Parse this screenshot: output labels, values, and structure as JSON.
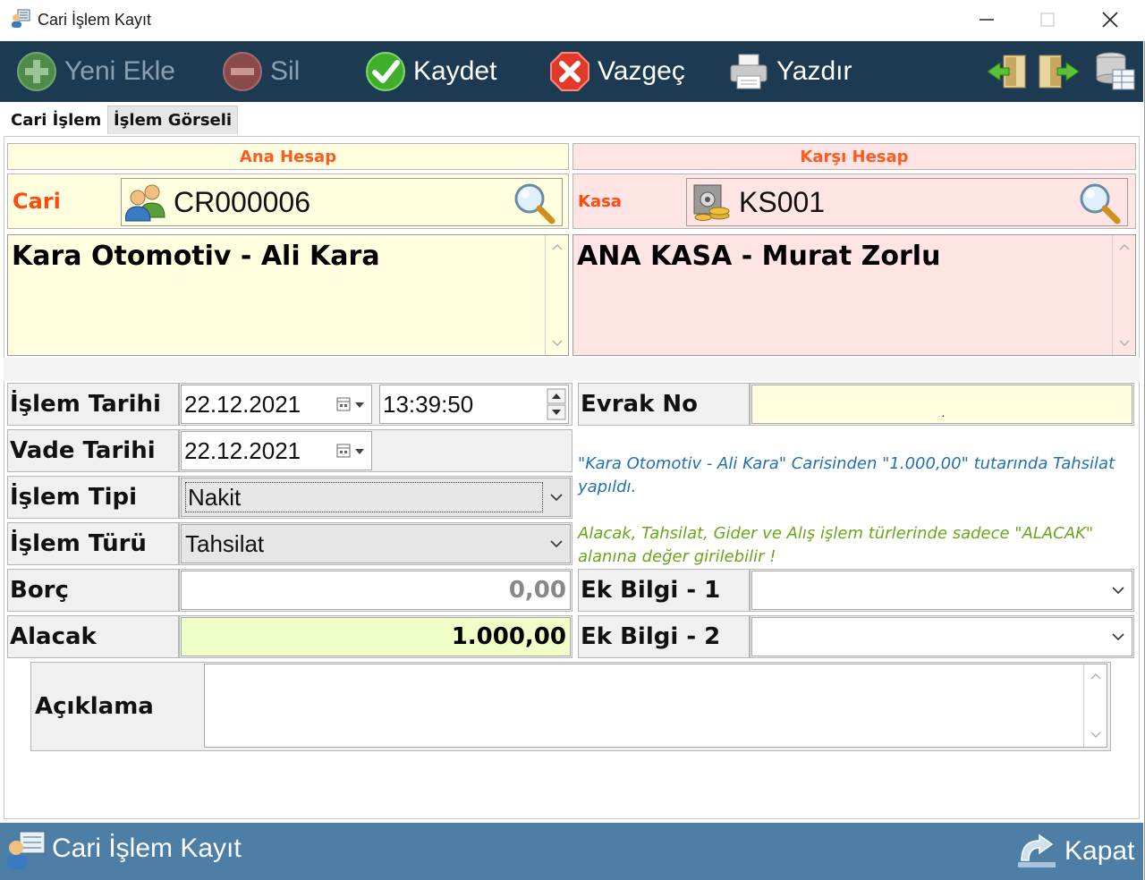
{
  "window": {
    "title": "Cari İşlem Kayıt"
  },
  "toolbar": {
    "new_label": "Yeni Ekle",
    "delete_label": "Sil",
    "save_label": "Kaydet",
    "cancel_label": "Vazgeç",
    "print_label": "Yazdır"
  },
  "tabs": [
    {
      "label": "Cari İşlem"
    },
    {
      "label": "İşlem Görseli"
    }
  ],
  "ana_hesap": {
    "header": "Ana Hesap",
    "type_label": "Cari",
    "code": "CR000006",
    "name": "Kara Otomotiv - Ali Kara"
  },
  "karsi_hesap": {
    "header": "Karşı Hesap",
    "type_label": "Kasa",
    "code": "KS001",
    "name": "ANA KASA - Murat Zorlu"
  },
  "form": {
    "islem_tarihi_label": "İşlem Tarihi",
    "islem_tarihi": "22.12.2021",
    "islem_saati": "13:39:50",
    "vade_tarihi_label": "Vade Tarihi",
    "vade_tarihi": "22.12.2021",
    "islem_tipi_label": "İşlem Tipi",
    "islem_tipi": "Nakit",
    "islem_turu_label": "İşlem Türü",
    "islem_turu": "Tahsilat",
    "borc_label": "Borç",
    "borc": "0,00",
    "alacak_label": "Alacak",
    "alacak": "1.000,00",
    "evrak_no_label": "Evrak No",
    "evrak_no": ".",
    "ek_bilgi_1_label": "Ek Bilgi - 1",
    "ek_bilgi_1": "",
    "ek_bilgi_2_label": "Ek Bilgi - 2",
    "ek_bilgi_2": "",
    "aciklama_label": "Açıklama",
    "aciklama": ""
  },
  "messages": {
    "summary": "\"Kara Otomotiv - Ali Kara\" Carisinden \"1.000,00\" tutarında Tahsilat yapıldı.",
    "hint": "Alacak, Tahsilat, Gider ve Alış işlem türlerinde sadece \"ALACAK\" alanına değer girilebilir !"
  },
  "footer": {
    "title": "Cari İşlem Kayıt",
    "close_label": "Kapat"
  },
  "colors": {
    "toolbar_bg": "#1c3a52",
    "footer_bg": "#4d7ea6",
    "ana_bg": "#ffffe0",
    "karsi_bg": "#ffe4e4",
    "header_text": "#ff5a1f",
    "summary_text": "#1f6fb5",
    "hint_text": "#6aa51a",
    "alacak_bg": "#f0ffc8"
  }
}
